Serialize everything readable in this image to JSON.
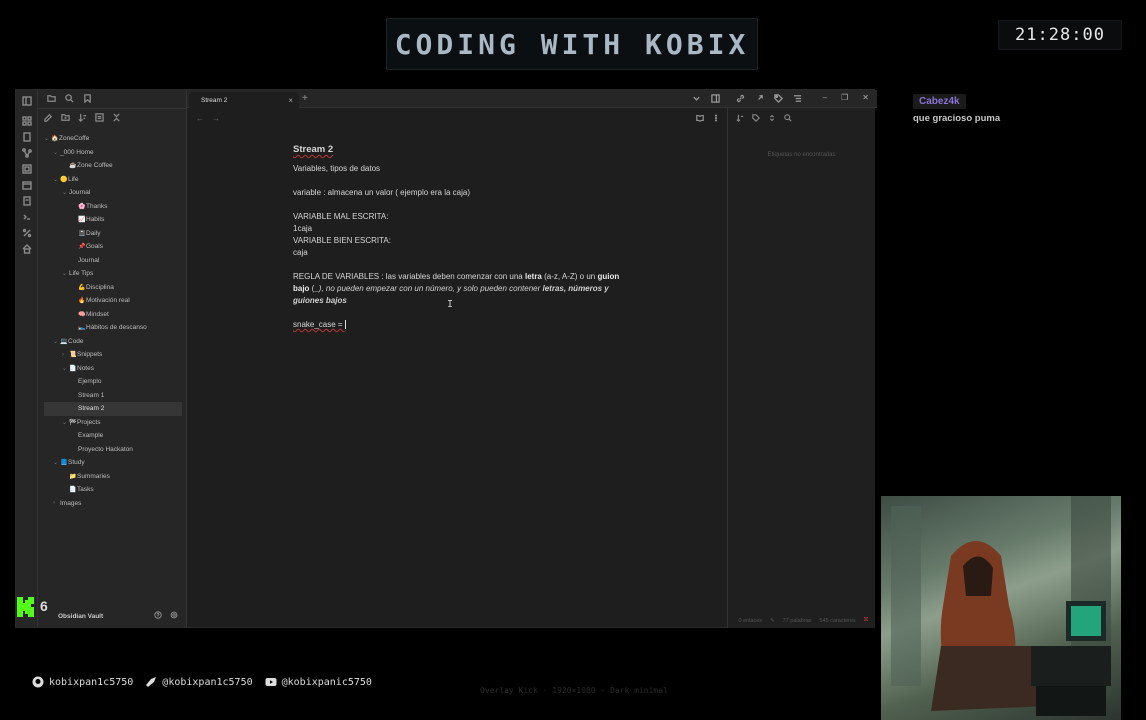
{
  "overlay": {
    "banner": "CODING WITH KOBIX",
    "clock": "21:28:00",
    "chat": {
      "user": "Cabez4k",
      "message": "que gracioso puma"
    },
    "socials": [
      "kobixpan1c5750",
      "@kobixpan1c5750",
      "@kobixpanic5750"
    ],
    "kick_count": "6"
  },
  "app": {
    "tab_title": "Stream 2",
    "tab_add": "+",
    "tree": [
      {
        "level": 0,
        "caret": "v",
        "icon": "🏠",
        "label": "ZoneCoffe"
      },
      {
        "level": 1,
        "caret": "v",
        "icon": "",
        "label": "_000 Home"
      },
      {
        "level": 2,
        "caret": "",
        "icon": "☕",
        "label": "Zone Coffee"
      },
      {
        "level": 1,
        "caret": "v",
        "icon": "🟡",
        "label": "Life"
      },
      {
        "level": 2,
        "caret": "v",
        "icon": "",
        "label": "Journal"
      },
      {
        "level": 3,
        "caret": "",
        "icon": "🌸",
        "label": "Thanks"
      },
      {
        "level": 3,
        "caret": "",
        "icon": "📈",
        "label": "Habits"
      },
      {
        "level": 3,
        "caret": "",
        "icon": "📓",
        "label": "Daily"
      },
      {
        "level": 3,
        "caret": "",
        "icon": "📌",
        "label": "Goals"
      },
      {
        "level": 3,
        "caret": "",
        "icon": "",
        "label": "Journal"
      },
      {
        "level": 2,
        "caret": "v",
        "icon": "",
        "label": "Life Tips"
      },
      {
        "level": 3,
        "caret": "",
        "icon": "💪",
        "label": "Disciplina"
      },
      {
        "level": 3,
        "caret": "",
        "icon": "🔥",
        "label": "Motivación real"
      },
      {
        "level": 3,
        "caret": "",
        "icon": "🧠",
        "label": "Mindset"
      },
      {
        "level": 3,
        "caret": "",
        "icon": "🛌",
        "label": "Hábitos de descanso"
      },
      {
        "level": 1,
        "caret": "v",
        "icon": "💻",
        "label": "Code"
      },
      {
        "level": 2,
        "caret": ">",
        "icon": "📜",
        "label": "Snippets"
      },
      {
        "level": 2,
        "caret": "v",
        "icon": "📄",
        "label": "Notes"
      },
      {
        "level": 3,
        "caret": "",
        "icon": "",
        "label": "Ejemplo"
      },
      {
        "level": 3,
        "caret": "",
        "icon": "",
        "label": "Stream 1"
      },
      {
        "level": 3,
        "caret": "",
        "icon": "",
        "label": "Stream 2",
        "active": true
      },
      {
        "level": 2,
        "caret": "v",
        "icon": "🏁",
        "label": "Projects"
      },
      {
        "level": 3,
        "caret": "",
        "icon": "",
        "label": "Example"
      },
      {
        "level": 3,
        "caret": "",
        "icon": "",
        "label": "Proyecto Hackaton"
      },
      {
        "level": 1,
        "caret": "v",
        "icon": "📘",
        "label": "Study"
      },
      {
        "level": 2,
        "caret": "",
        "icon": "📁",
        "label": "Summaries"
      },
      {
        "level": 2,
        "caret": "",
        "icon": "📄",
        "label": "Tasks"
      },
      {
        "level": 1,
        "caret": ">",
        "icon": "",
        "label": "Images"
      }
    ],
    "vault_name": "Obsidian Vault",
    "note": {
      "title": "Stream 2",
      "line1": "Variables, tipos de datos",
      "line2": "variable :  almacena un valor ( ejemplo era la caja)",
      "bad_heading": "VARIABLE MAL ESCRITA:",
      "bad_example": "1caja",
      "good_heading": "VARIABLE BIEN ESCRITA:",
      "good_example": "caja",
      "rule_a": "REGLA DE VARIABLES : las variables deben comenzar con una ",
      "rule_b": "letra",
      "rule_c": " (a-z, A-Z) o un ",
      "rule_d": "guion bajo",
      "rule_e": " (",
      "rule_f": "_",
      "rule_g": "), no pueden empezar con un número, y solo pueden contener ",
      "rule_h": "letras, números y guiones bajos",
      "snake": "snake_case = "
    },
    "right_panel_empty": "Etiquetas no encontradas",
    "status": {
      "backlinks": "0 enlaces",
      "words": "77 palabras",
      "chars": "545 caracteres"
    }
  },
  "footer_note": "Overlay Kick · 1920×1080 · Dark minimal"
}
